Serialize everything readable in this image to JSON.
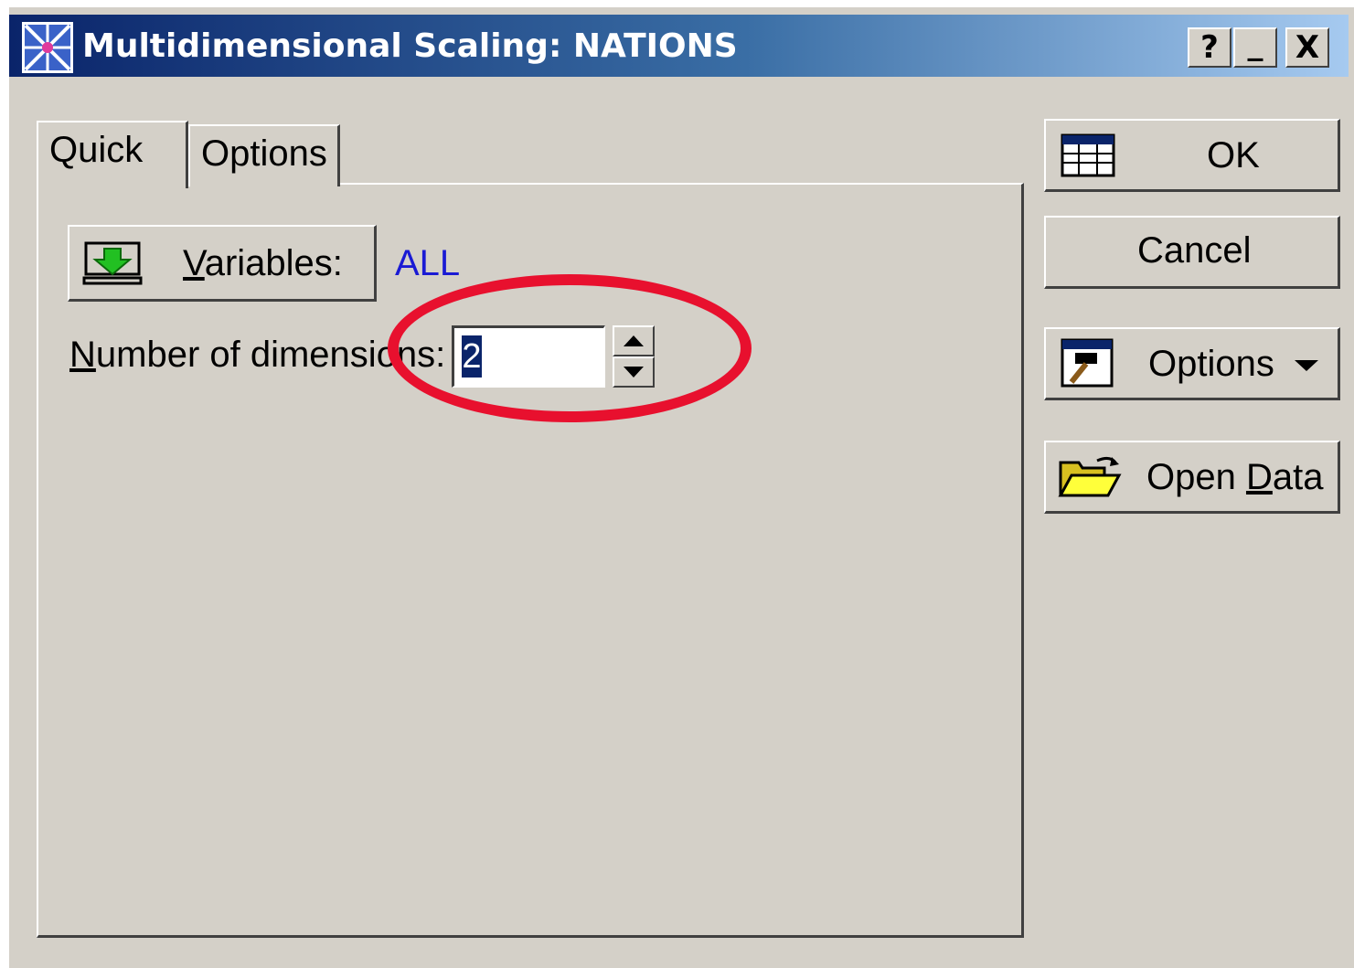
{
  "window": {
    "title": "Multidimensional Scaling: NATIONS",
    "help_label": "?",
    "minimize_label": "_",
    "close_label": "X",
    "app_icon": "statistica-app-icon"
  },
  "tabs": [
    {
      "label": "Quick",
      "active": true
    },
    {
      "label": "Options",
      "active": false
    }
  ],
  "quick": {
    "variables_button": {
      "prefix": "",
      "mnemonic": "V",
      "rest": "ariables:",
      "icon": "variables-select-icon"
    },
    "variables_value": "ALL",
    "dimensions": {
      "mnemonic": "N",
      "rest": "umber of dimensions:",
      "value": "2"
    }
  },
  "side_buttons": {
    "ok": {
      "label": "OK",
      "icon": "spreadsheet-icon"
    },
    "cancel": {
      "label": "Cancel"
    },
    "options": {
      "label": "Options",
      "icon": "hammer-icon"
    },
    "open_data": {
      "prefix": "Open ",
      "mnemonic": "D",
      "rest": "ata",
      "icon": "open-folder-icon"
    }
  },
  "colors": {
    "face": "#d4d0c8",
    "titlebar_start": "#0a246a",
    "titlebar_end": "#a6caf0",
    "link": "#1a1ad4",
    "highlight_ring": "#e8102e"
  }
}
